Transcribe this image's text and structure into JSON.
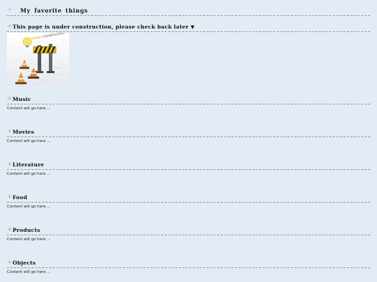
{
  "page": {
    "title": "My favorite things"
  },
  "notice": {
    "heading": "This page is under construction, please check back later",
    "toggle_icon": "triangle-down-icon",
    "image_text": "Under Construction"
  },
  "sections": [
    {
      "heading": "Music",
      "content": "Content will go here ..."
    },
    {
      "heading": "Movies",
      "content": "Content will go here ..."
    },
    {
      "heading": "Literature",
      "content": "Content will go here ..."
    },
    {
      "heading": "Food",
      "content": "Content will go here ..."
    },
    {
      "heading": "Products",
      "content": "Content will go here ..."
    },
    {
      "heading": "Objects",
      "content": "Content will go here ..."
    }
  ],
  "icons": {
    "expand": "plus-icon"
  },
  "colors": {
    "background": "#e3ebf4",
    "divider": "#8a94a3",
    "plus": "#a4acb8"
  }
}
